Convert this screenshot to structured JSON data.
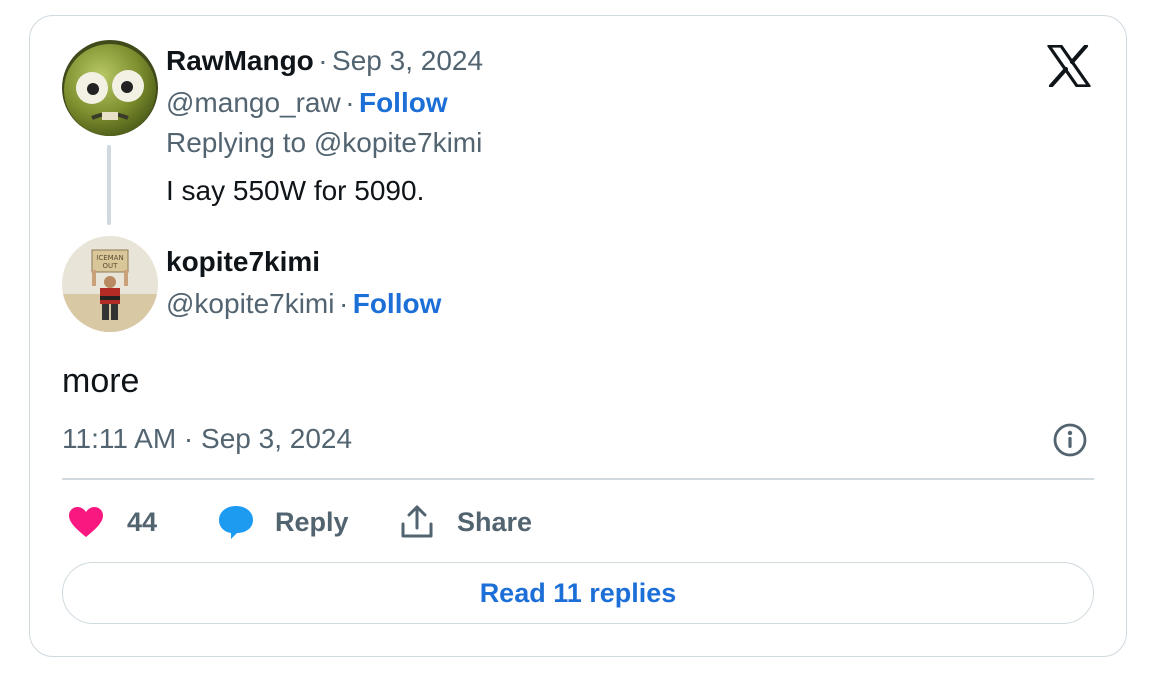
{
  "reply": {
    "author_name": "RawMango",
    "separator": "·",
    "date": "Sep 3, 2024",
    "handle": "@mango_raw",
    "follow_label": "Follow",
    "replying_to": "Replying to @kopite7kimi",
    "text": "I say 550W for 5090."
  },
  "tweet": {
    "author_name": "kopite7kimi",
    "handle": "@kopite7kimi",
    "follow_label": "Follow",
    "avatar_sign_line1": "ICEMAN",
    "avatar_sign_line2": "OUT",
    "text": "more",
    "timestamp": "11:11 AM · Sep 3, 2024"
  },
  "actions": {
    "like_count": "44",
    "reply_label": "Reply",
    "share_label": "Share"
  },
  "read_replies_label": "Read 11 replies",
  "icons": {
    "brand": "x-logo-icon",
    "info": "info-icon",
    "like": "heart-icon",
    "reply": "speech-bubble-icon",
    "share": "share-icon"
  },
  "colors": {
    "link": "#1d6fd8",
    "heart": "#f91880",
    "reply_bubble": "#1d9bf0",
    "muted": "#536471",
    "border": "#cfd9de"
  }
}
